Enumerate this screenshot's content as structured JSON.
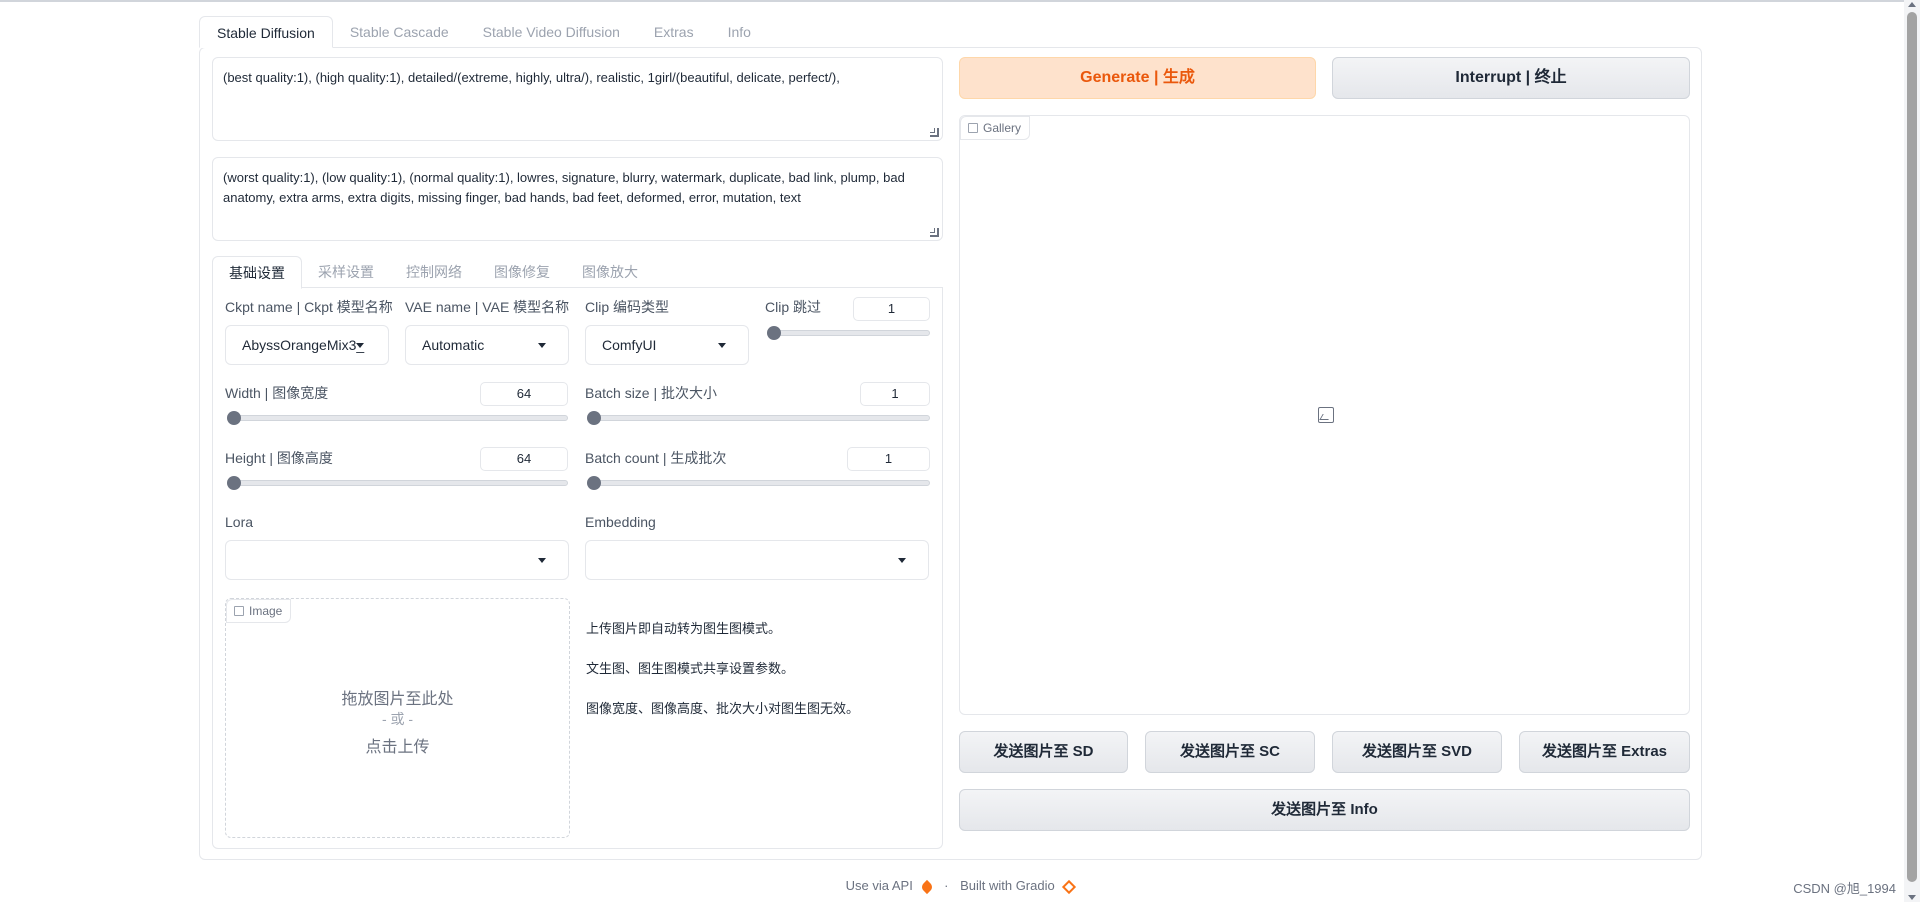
{
  "top_tabs": [
    "Stable Diffusion",
    "Stable Cascade",
    "Stable Video Diffusion",
    "Extras",
    "Info"
  ],
  "prompt": {
    "positive": "(best quality:1), (high quality:1), detailed/(extreme, highly, ultra/), realistic, 1girl/(beautiful, delicate, perfect/),",
    "negative": "(worst quality:1), (low quality:1), (normal quality:1), lowres, signature, blurry, watermark, duplicate, bad link, plump, bad anatomy, extra arms, extra digits, missing finger, bad hands, bad feet, deformed, error, mutation, text"
  },
  "sub_tabs": [
    "基础设置",
    "采样设置",
    "控制网络",
    "图像修复",
    "图像放大"
  ],
  "settings": {
    "ckpt": {
      "label": "Ckpt name | Ckpt 模型名称",
      "value": "AbyssOrangeMix3_"
    },
    "vae": {
      "label": "VAE name | VAE 模型名称",
      "value": "Automatic"
    },
    "clip_type": {
      "label": "Clip 编码类型",
      "value": "ComfyUI"
    },
    "clip_skip": {
      "label": "Clip 跳过",
      "value": "1",
      "fraction": 0.0
    },
    "width": {
      "label": "Width | 图像宽度",
      "value": "64",
      "fraction": 0.0
    },
    "batch_size": {
      "label": "Batch size | 批次大小",
      "value": "1",
      "fraction": 0.0
    },
    "height": {
      "label": "Height | 图像高度",
      "value": "64",
      "fraction": 0.0
    },
    "batch_count": {
      "label": "Batch count | 生成批次",
      "value": "1",
      "fraction": 0.0
    },
    "lora": {
      "label": "Lora",
      "value": ""
    },
    "embedding": {
      "label": "Embedding",
      "value": ""
    }
  },
  "image_upload": {
    "label": "Image",
    "line1": "拖放图片至此处",
    "line2": "- 或 -",
    "line3": "点击上传"
  },
  "info_lines": [
    "上传图片即自动转为图生图模式。",
    "文生图、图生图模式共享设置参数。",
    "图像宽度、图像高度、批次大小对图生图无效。"
  ],
  "buttons": {
    "generate": "Generate | 生成",
    "interrupt": "Interrupt | 终止",
    "send_sd": "发送图片至 SD",
    "send_sc": "发送图片至 SC",
    "send_svd": "发送图片至 SVD",
    "send_extras": "发送图片至 Extras",
    "send_info": "发送图片至 Info"
  },
  "gallery": {
    "label": "Gallery"
  },
  "footer": {
    "api": "Use via API",
    "sep": "·",
    "built": "Built with Gradio"
  },
  "watermark": "CSDN @旭_1994"
}
